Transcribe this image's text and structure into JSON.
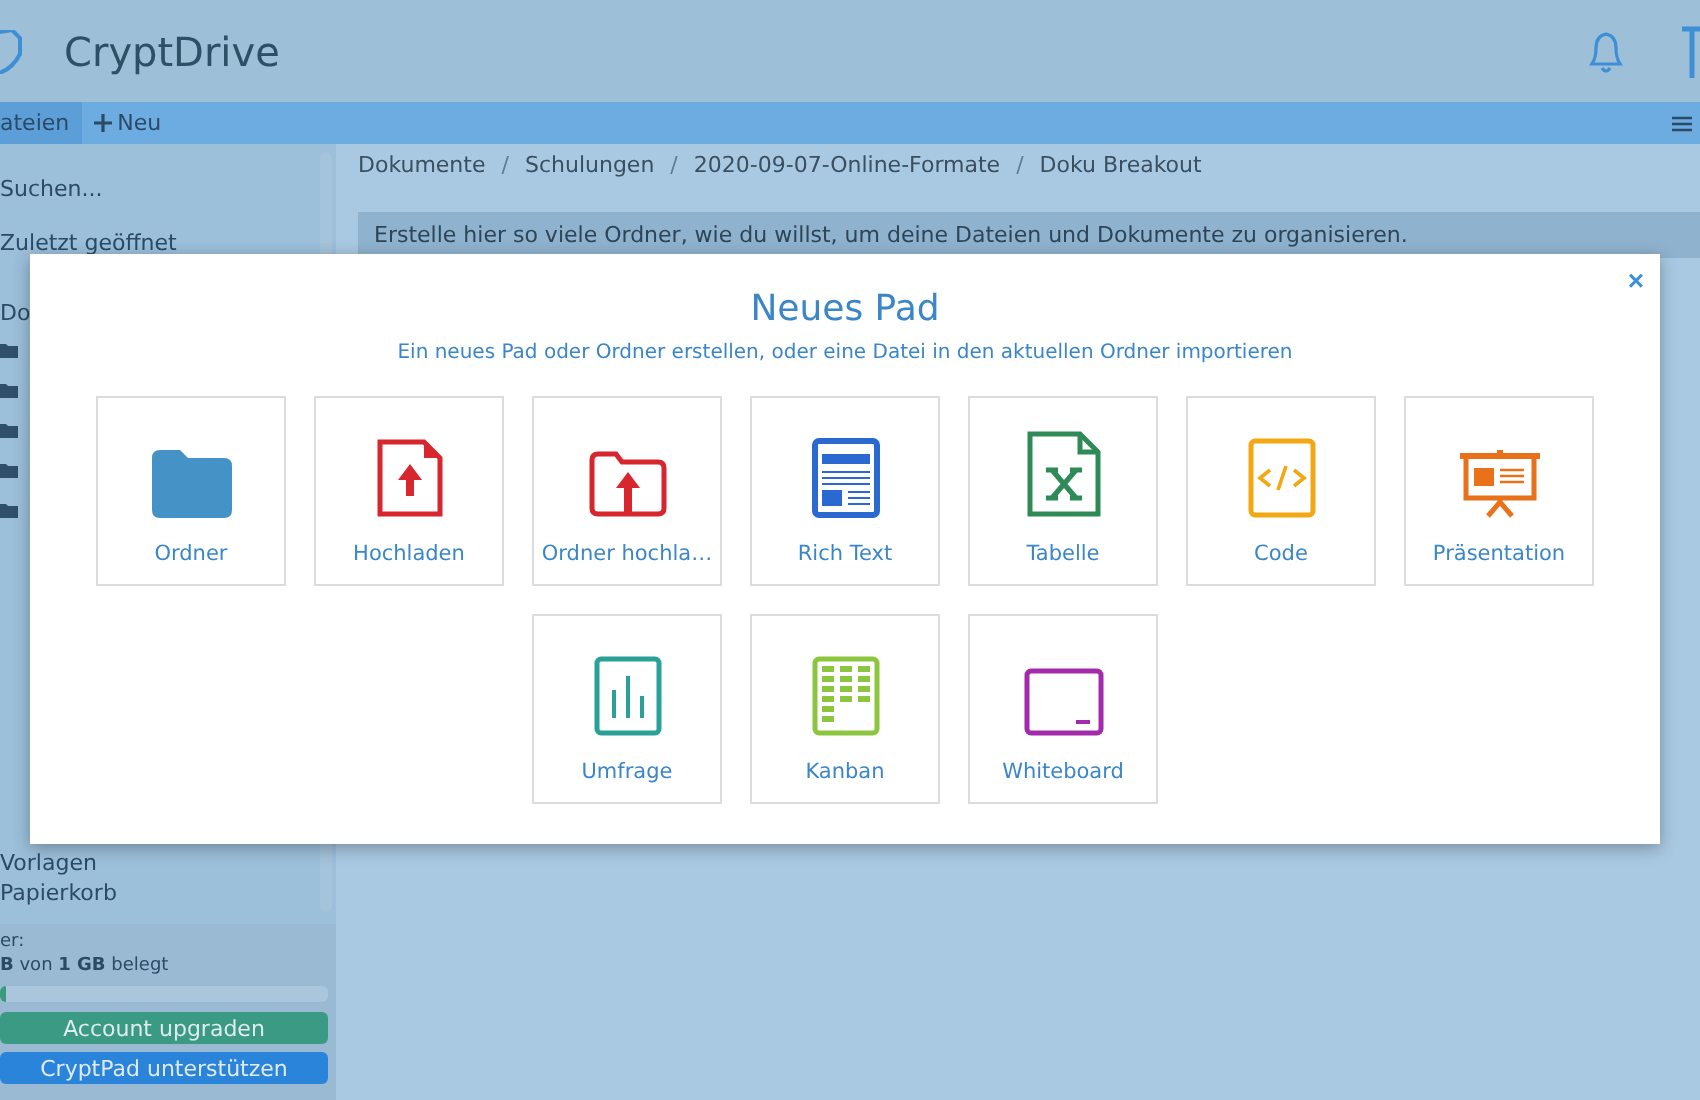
{
  "header": {
    "title": "CryptDrive"
  },
  "toolbar": {
    "tab": "ateien",
    "new_button": "Neu"
  },
  "sidebar": {
    "search": "Suchen...",
    "recent": "Zuletzt geöffnet",
    "documents": "Do",
    "templates": "Vorlagen",
    "trash": "Papierkorb",
    "storage_label": "er:",
    "storage_usage": "**B** von **1 GB** belegt",
    "storage_bar": {
      "level": 0.02
    },
    "upgrade_button": "Account upgraden",
    "support_button": "CryptPad unterstützen"
  },
  "breadcrumbs": [
    "Dokumente",
    "Schulungen",
    "2020-09-07-Online-Formate",
    "Doku Breakout"
  ],
  "breadcrumb_separator": "/",
  "info": "Erstelle hier so viele Ordner, wie du willst, um deine Dateien und Dokumente zu organisieren.",
  "modal": {
    "title": "Neues Pad",
    "subtitle": "Ein neues Pad oder Ordner erstellen, oder eine Datei in den aktuellen Ordner importieren",
    "close": "×",
    "tiles": [
      {
        "label": "Ordner",
        "kind": "folder"
      },
      {
        "label": "Hochladen",
        "kind": "upload"
      },
      {
        "label": "Ordner hochla…",
        "kind": "folder-upload"
      },
      {
        "label": "Rich Text",
        "kind": "richtext"
      },
      {
        "label": "Tabelle",
        "kind": "sheet"
      },
      {
        "label": "Code",
        "kind": "code"
      },
      {
        "label": "Präsentation",
        "kind": "slide"
      },
      {
        "label": "Umfrage",
        "kind": "poll"
      },
      {
        "label": "Kanban",
        "kind": "kanban"
      },
      {
        "label": "Whiteboard",
        "kind": "whiteboard"
      }
    ]
  }
}
